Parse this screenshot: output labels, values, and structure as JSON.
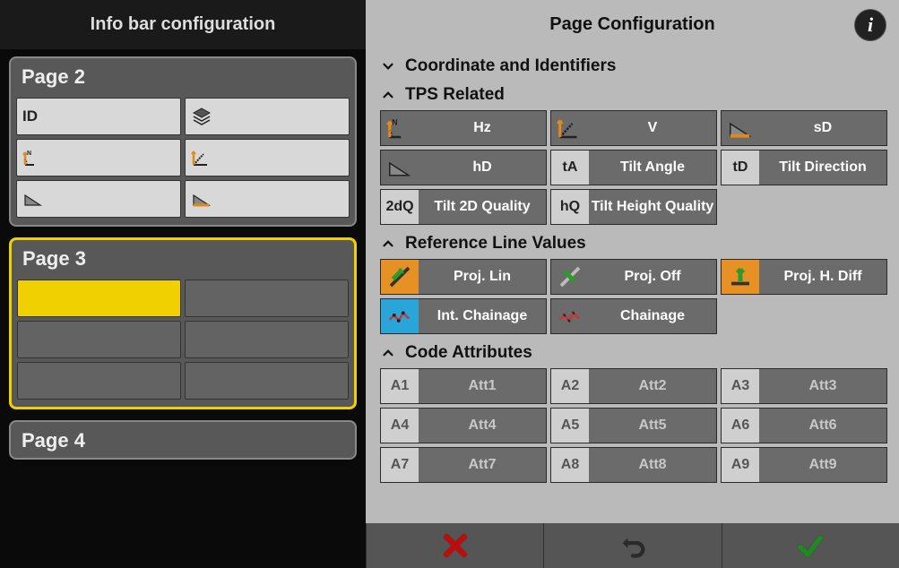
{
  "left_panel": {
    "title": "Info bar configuration",
    "pages": [
      {
        "title": "Page 2",
        "selected": false,
        "slots": [
          {
            "label": "ID",
            "icon": null,
            "style": "light"
          },
          {
            "label": "",
            "icon": "layers-icon",
            "style": "light"
          },
          {
            "label": "",
            "icon": "angle-hz-icon",
            "style": "light"
          },
          {
            "label": "",
            "icon": "angle-v-icon",
            "style": "light"
          },
          {
            "label": "",
            "icon": "slope-icon",
            "style": "light"
          },
          {
            "label": "",
            "icon": "slope-color-icon",
            "style": "light"
          }
        ]
      },
      {
        "title": "Page 3",
        "selected": true,
        "slots": [
          {
            "label": "",
            "icon": null,
            "style": "hl"
          },
          {
            "label": "",
            "icon": null,
            "style": "dark"
          },
          {
            "label": "",
            "icon": null,
            "style": "dark"
          },
          {
            "label": "",
            "icon": null,
            "style": "dark"
          },
          {
            "label": "",
            "icon": null,
            "style": "dark"
          },
          {
            "label": "",
            "icon": null,
            "style": "dark"
          }
        ]
      },
      {
        "title": "Page 4",
        "selected": false,
        "slots": []
      }
    ]
  },
  "right_panel": {
    "title": "Page Configuration",
    "sections": [
      {
        "title": "Coordinate and Identifiers",
        "expanded": false,
        "tiles": []
      },
      {
        "title": "TPS Related",
        "expanded": true,
        "tiles": [
          {
            "icon": "angle-hz-icon",
            "icon_text": "",
            "label": "Hz",
            "faded": false,
            "icon_dark": true
          },
          {
            "icon": "angle-v-icon",
            "icon_text": "",
            "label": "V",
            "faded": false,
            "icon_dark": true
          },
          {
            "icon": "slope-color-icon",
            "icon_text": "",
            "label": "sD",
            "faded": false,
            "icon_dark": true
          },
          {
            "icon": "slope-icon",
            "icon_text": "",
            "label": "hD",
            "faded": false,
            "icon_dark": true
          },
          {
            "icon": null,
            "icon_text": "tA",
            "label": "Tilt Angle",
            "faded": false,
            "icon_dark": false
          },
          {
            "icon": null,
            "icon_text": "tD",
            "label": "Tilt Direction",
            "faded": false,
            "icon_dark": false
          },
          {
            "icon": null,
            "icon_text": "2dQ",
            "label": "Tilt 2D Quality",
            "faded": false,
            "icon_dark": false
          },
          {
            "icon": null,
            "icon_text": "hQ",
            "label": "Tilt Height Quality",
            "faded": false,
            "icon_dark": false
          }
        ]
      },
      {
        "title": "Reference Line Values",
        "expanded": true,
        "tiles": [
          {
            "icon": "proj-lin-icon",
            "icon_text": "",
            "label": "Proj. Lin",
            "faded": false,
            "icon_dark": false,
            "icon_bg": "#e79024"
          },
          {
            "icon": "proj-off-icon",
            "icon_text": "",
            "label": "Proj. Off",
            "faded": false,
            "icon_dark": true
          },
          {
            "icon": "proj-hdiff-icon",
            "icon_text": "",
            "label": "Proj. H. Diff",
            "faded": false,
            "icon_dark": false,
            "icon_bg": "#e79024"
          },
          {
            "icon": "int-chainage-icon",
            "icon_text": "",
            "label": "Int. Chainage",
            "faded": false,
            "icon_dark": false,
            "icon_bg": "#2aa5d9"
          },
          {
            "icon": "chainage-icon",
            "icon_text": "",
            "label": "Chainage",
            "faded": false,
            "icon_dark": true
          }
        ]
      },
      {
        "title": "Code Attributes",
        "expanded": true,
        "tiles": [
          {
            "icon": null,
            "icon_text": "A1",
            "label": "Att1",
            "faded": true
          },
          {
            "icon": null,
            "icon_text": "A2",
            "label": "Att2",
            "faded": true
          },
          {
            "icon": null,
            "icon_text": "A3",
            "label": "Att3",
            "faded": true
          },
          {
            "icon": null,
            "icon_text": "A4",
            "label": "Att4",
            "faded": true
          },
          {
            "icon": null,
            "icon_text": "A5",
            "label": "Att5",
            "faded": true
          },
          {
            "icon": null,
            "icon_text": "A6",
            "label": "Att6",
            "faded": true
          },
          {
            "icon": null,
            "icon_text": "A7",
            "label": "Att7",
            "faded": true
          },
          {
            "icon": null,
            "icon_text": "A8",
            "label": "Att8",
            "faded": true
          },
          {
            "icon": null,
            "icon_text": "A9",
            "label": "Att9",
            "faded": true
          }
        ]
      }
    ]
  },
  "bottom_bar": {
    "buttons": [
      "cancel",
      "undo",
      "confirm"
    ]
  }
}
